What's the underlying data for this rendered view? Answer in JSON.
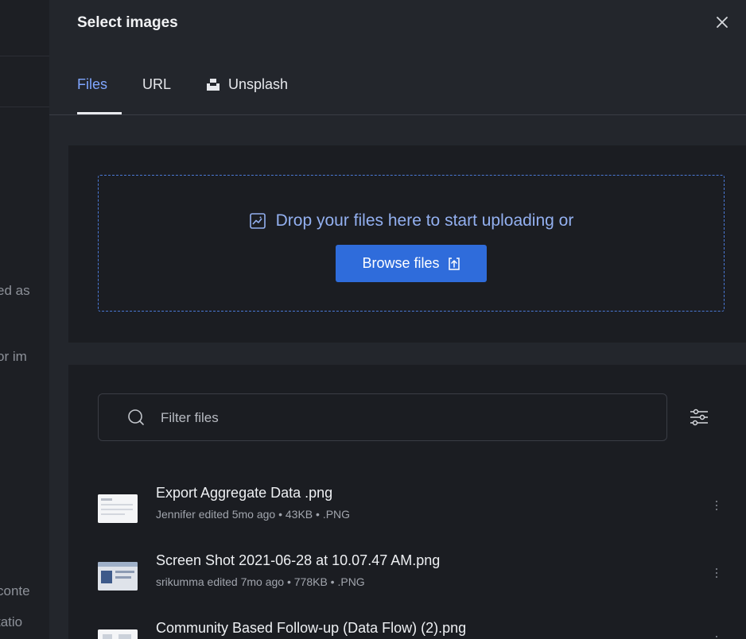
{
  "background": {
    "fragments": [
      "ed as",
      "or im",
      "conte",
      "tatio"
    ]
  },
  "modal": {
    "title": "Select images",
    "tabs": [
      {
        "label": "Files",
        "active": true
      },
      {
        "label": "URL",
        "active": false
      },
      {
        "label": "Unsplash",
        "active": false,
        "icon": "unsplash-icon"
      }
    ]
  },
  "upload": {
    "drop_text": "Drop your files here to start uploading or",
    "browse_label": "Browse files"
  },
  "files": {
    "filter_placeholder": "Filter files",
    "items": [
      {
        "name": "Export Aggregate Data .png",
        "meta": "Jennifer edited 5mo ago • 43KB • .PNG"
      },
      {
        "name": "Screen Shot 2021-06-28 at 10.07.47 AM.png",
        "meta": "srikumma edited 7mo ago • 778KB • .PNG"
      },
      {
        "name": "Community Based Follow-up (Data Flow) (2).png",
        "meta": ""
      }
    ]
  },
  "colors": {
    "accent": "#2f6cdb",
    "active_tab": "#7fa6ff",
    "dropzone_border": "#4a78d4"
  }
}
